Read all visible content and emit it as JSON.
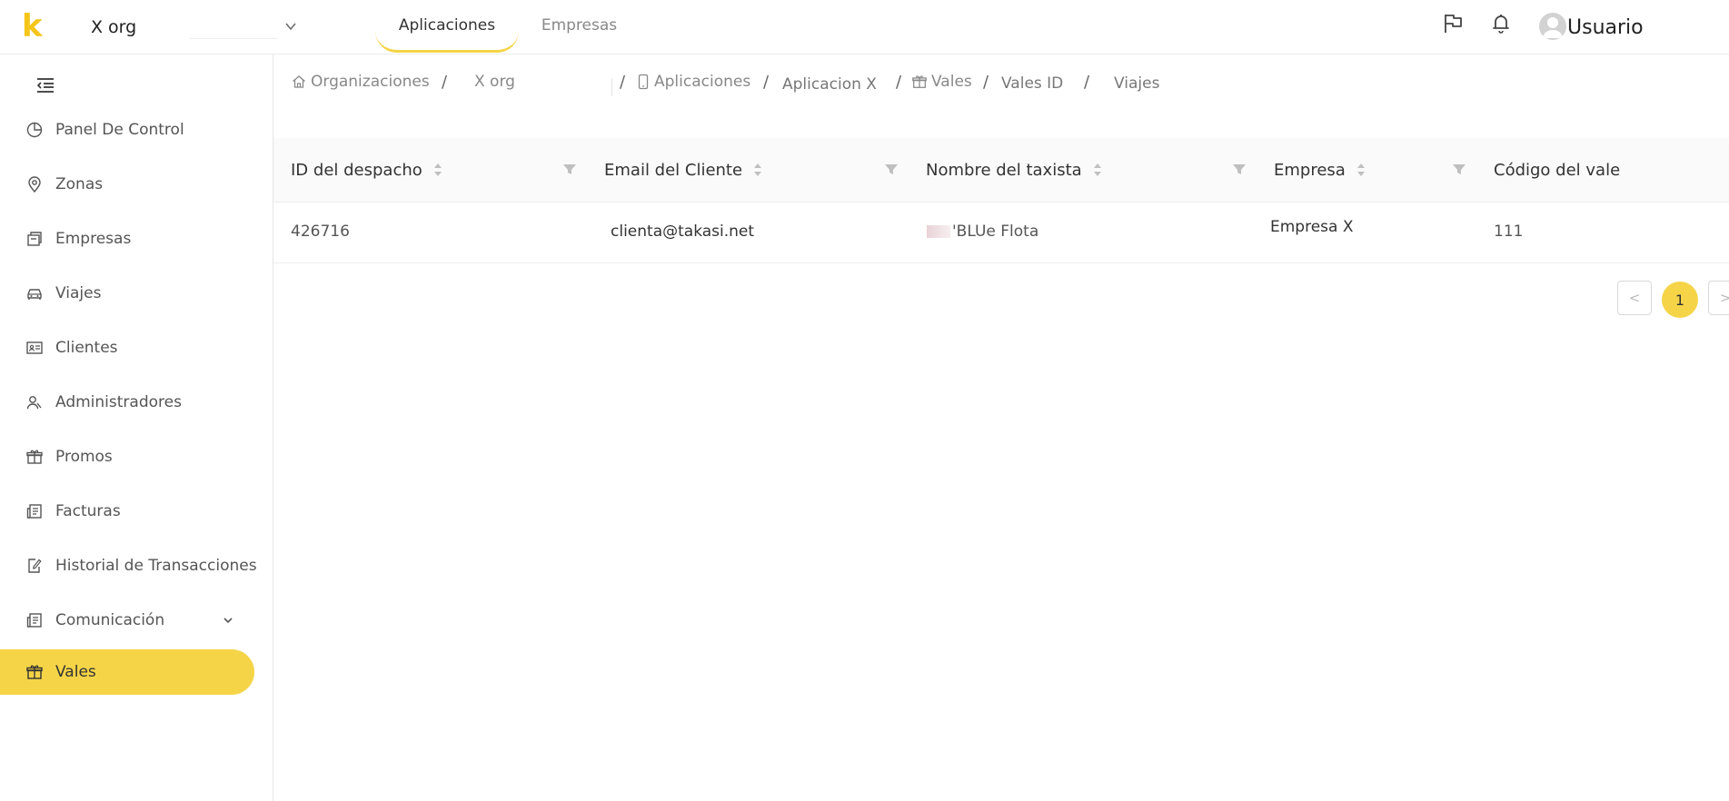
{
  "header": {
    "logo": "k",
    "org_name": "X org",
    "tabs": [
      {
        "label": "Aplicaciones",
        "active": true
      },
      {
        "label": "Empresas",
        "active": false
      }
    ],
    "user_name": "Usuario"
  },
  "sidebar": {
    "items": [
      {
        "label": "Panel De Control",
        "icon": "pie-chart-icon"
      },
      {
        "label": "Zonas",
        "icon": "location-pin-icon"
      },
      {
        "label": "Empresas",
        "icon": "building-icon"
      },
      {
        "label": "Viajes",
        "icon": "car-icon"
      },
      {
        "label": "Clientes",
        "icon": "id-card-icon"
      },
      {
        "label": "Administradores",
        "icon": "users-icon"
      },
      {
        "label": "Promos",
        "icon": "gift-icon"
      },
      {
        "label": "Facturas",
        "icon": "invoice-icon"
      },
      {
        "label": "Historial de Transacciones",
        "icon": "edit-document-icon"
      },
      {
        "label": "Comunicación",
        "icon": "invoice-icon",
        "expandable": true
      },
      {
        "label": "Vales",
        "icon": "gift-icon",
        "active": true
      }
    ]
  },
  "breadcrumb": {
    "items": [
      {
        "label": "Organizaciones",
        "icon": "home-icon"
      },
      {
        "label": "X org"
      },
      {
        "label": "Aplicaciones",
        "icon": "mobile-icon"
      },
      {
        "label": "Aplicacion X"
      },
      {
        "label": "Vales",
        "icon": "gift-icon"
      },
      {
        "label": "Vales ID"
      },
      {
        "label": "Viajes"
      }
    ],
    "separator": "/"
  },
  "table": {
    "columns": [
      {
        "label": "ID del despacho"
      },
      {
        "label": "Email del Cliente"
      },
      {
        "label": "Nombre del taxista"
      },
      {
        "label": "Empresa"
      },
      {
        "label": "Código del vale"
      }
    ],
    "rows": [
      {
        "dispatch_id": "426716",
        "client_email": "clienta@takasi.net",
        "driver_name": "'BLUe Flota",
        "company": "Empresa X",
        "voucher_code": "111"
      }
    ]
  },
  "pagination": {
    "current_page": "1",
    "prev": "<",
    "next": ">"
  },
  "colors": {
    "accent": "#f5d547",
    "logo": "#f5c518"
  }
}
